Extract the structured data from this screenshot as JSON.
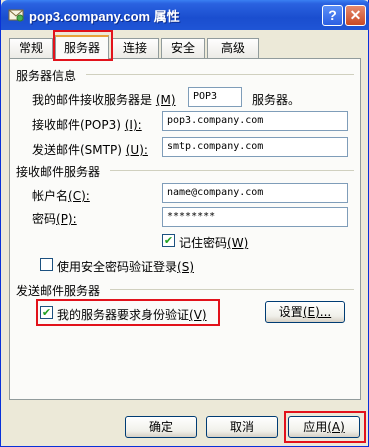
{
  "window": {
    "title": "pop3.company.com 属性",
    "help_label": "?",
    "close_label": "✕"
  },
  "tabs": [
    {
      "label": "常规"
    },
    {
      "label": "服务器"
    },
    {
      "label": "连接"
    },
    {
      "label": "安全"
    },
    {
      "label": "高级"
    }
  ],
  "server_info": {
    "section_title": "服务器信息",
    "incoming_type_prefix": "我的邮件接收服务器是",
    "incoming_type_key": "(M)",
    "incoming_type_value": "POP3",
    "incoming_type_suffix": "服务器。",
    "incoming_label": "接收邮件(POP3)",
    "incoming_key": "(I):",
    "incoming_value": "pop3.company.com",
    "outgoing_label": "发送邮件(SMTP)",
    "outgoing_key": "(U):",
    "outgoing_value": "smtp.company.com"
  },
  "incoming_server": {
    "section_title": "接收邮件服务器",
    "account_label": "帐户名",
    "account_key": "(C):",
    "account_value": "name@company.com",
    "password_label": "密码",
    "password_key": "(P):",
    "password_value": "********",
    "remember_label": "记住密码",
    "remember_key": "(W)",
    "remember_checked": true,
    "spa_label": "使用安全密码验证登录",
    "spa_key": "(S)",
    "spa_checked": false
  },
  "outgoing_server": {
    "section_title": "发送邮件服务器",
    "auth_label": "我的服务器要求身份验证",
    "auth_key": "(V)",
    "auth_checked": true,
    "settings_label": "设置",
    "settings_key": "(E)..."
  },
  "footer": {
    "ok_label": "确定",
    "cancel_label": "取消",
    "apply_label": "应用",
    "apply_key": "(A)"
  },
  "colors": {
    "titlebar": "#1f55d6",
    "highlight_box": "#e2121b",
    "check": "#21a121"
  }
}
